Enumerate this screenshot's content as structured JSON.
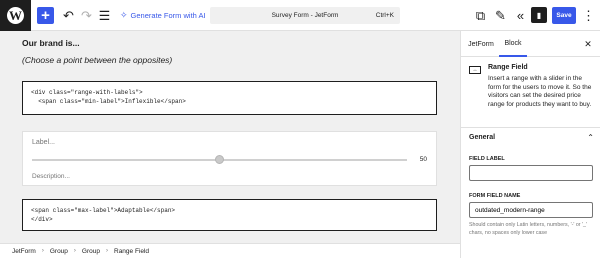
{
  "topbar": {
    "gen_icon": "sparkle-icon",
    "generate_label": "Generate Form with AI",
    "command_title": "Survey Form - JetForm",
    "command_shortcut": "Ctrl+K",
    "save_label": "Save",
    "icons": [
      "wordpress-logo-icon",
      "plus-icon",
      "undo-icon",
      "redo-icon",
      "list-view-icon",
      "external-link-icon",
      "edit-icon",
      "collapse-icon",
      "sidebar-icon",
      "more-icon"
    ]
  },
  "canvas": {
    "heading": "Our brand is...",
    "subheading": "(Choose a point between the opposites)",
    "code1": "<div class=\"range-with-labels\">\n  <span class=\"min-label\">Inflexible</span>",
    "field_label": "Label...",
    "range_value": "50",
    "range_level": 0.5,
    "field_description": "Description...",
    "code2": "<span class=\"max-label\">Adaptable</span>\n</div>"
  },
  "breadcrumb": [
    "JetForm",
    "Group",
    "Group",
    "Range Field"
  ],
  "sidebar": {
    "tabs": [
      "JetForm",
      "Block"
    ],
    "active_tab": "Block",
    "block_title": "Range Field",
    "block_description": "Insert a range with a slider in the form for the users to move it. So the visitors can set the desired price range for products they want to buy.",
    "panel_title": "General",
    "field_label_label": "FIELD LABEL",
    "field_label_value": "",
    "field_name_label": "FORM FIELD NAME",
    "field_name_value": "outdated_modern-range",
    "help_text": "Should contain only Latin letters, numbers, '-' or '_' chars, no spaces only lower case"
  },
  "colors": {
    "accent": "#3858e9",
    "dark": "#1e1e1e"
  }
}
